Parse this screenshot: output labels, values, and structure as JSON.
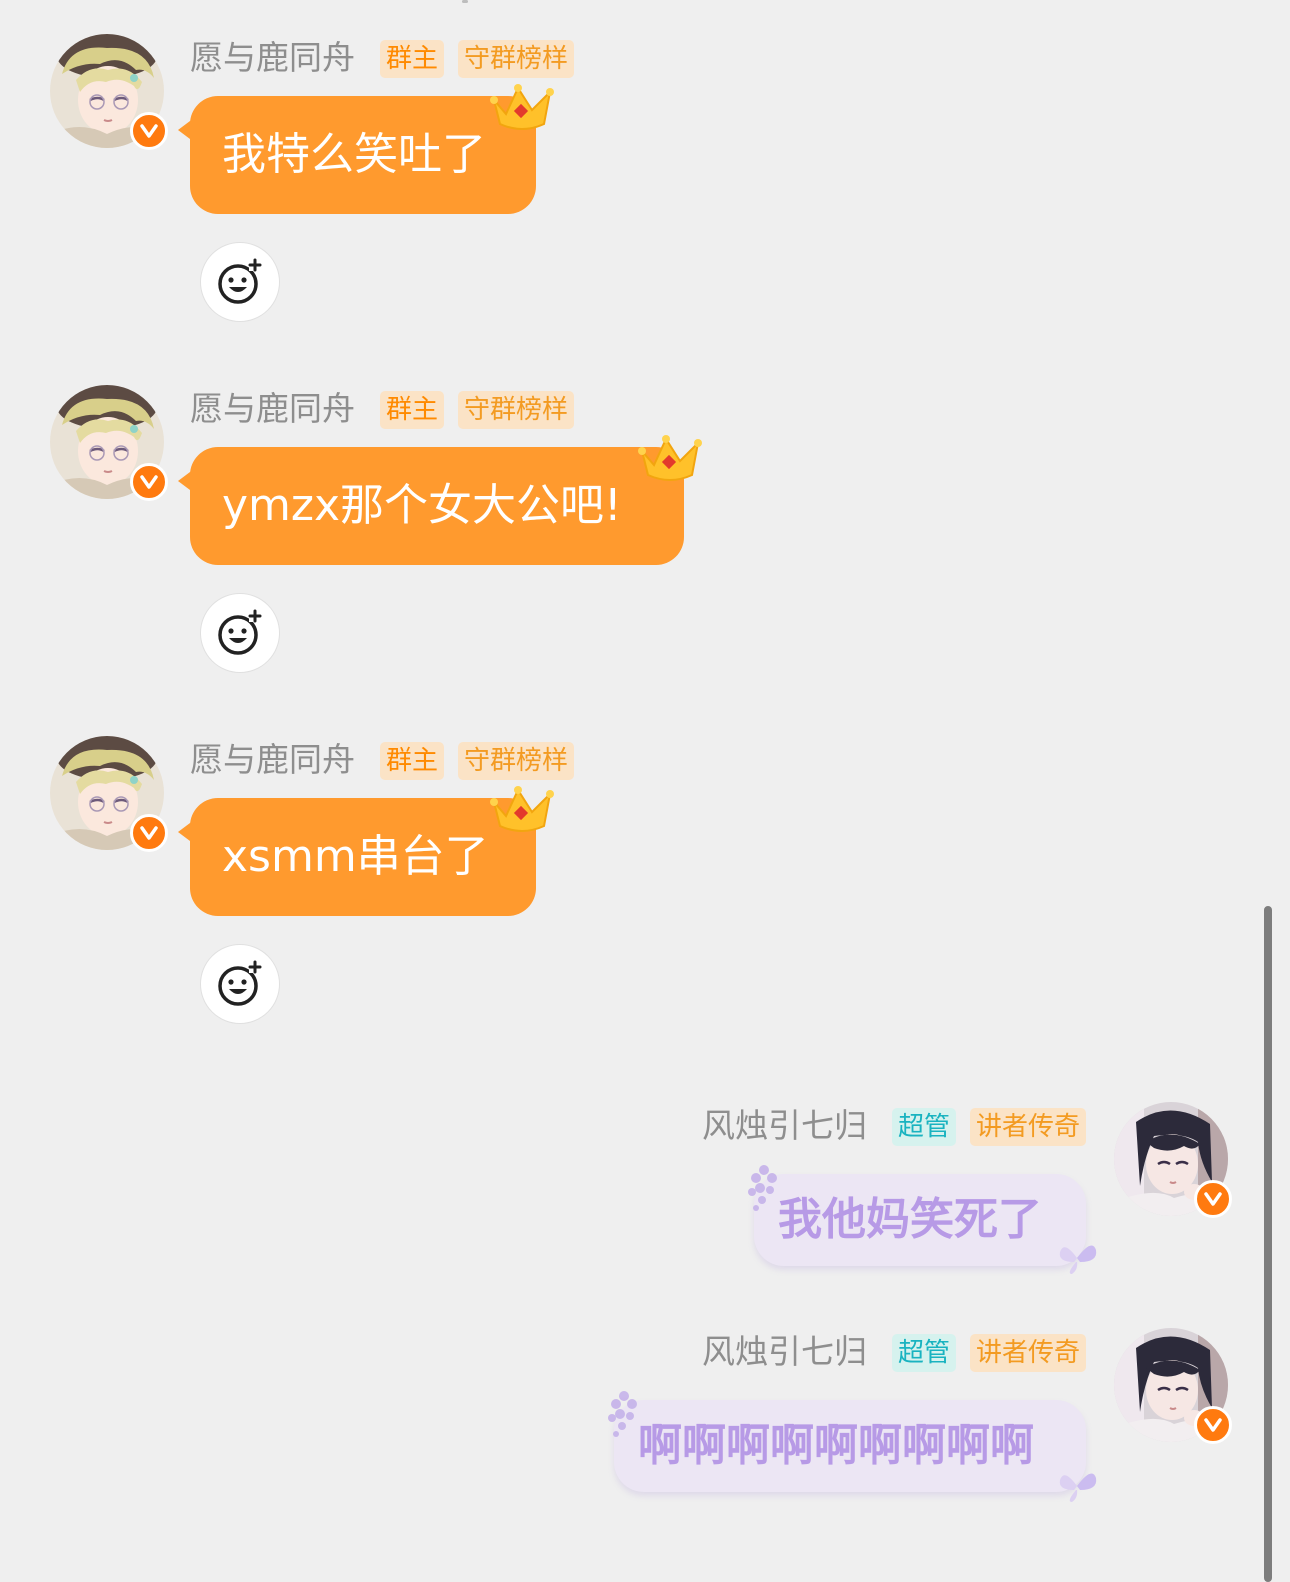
{
  "messages": [
    {
      "sender": "愿与鹿同舟",
      "badges": [
        "群主",
        "守群榜样"
      ],
      "text": "我特么笑吐了",
      "side": "left"
    },
    {
      "sender": "愿与鹿同舟",
      "badges": [
        "群主",
        "守群榜样"
      ],
      "text": "ymzx那个女大公吧!",
      "side": "left"
    },
    {
      "sender": "愿与鹿同舟",
      "badges": [
        "群主",
        "守群榜样"
      ],
      "text": "xsmm串台了",
      "side": "left"
    },
    {
      "sender": "风烛引七归",
      "badges": [
        "超管",
        "讲者传奇"
      ],
      "text": "我他妈笑死了",
      "side": "right"
    },
    {
      "sender": "风烛引七归",
      "badges": [
        "超管",
        "讲者传奇"
      ],
      "text": "啊啊啊啊啊啊啊啊啊",
      "side": "right"
    }
  ],
  "colors": {
    "background": "#efefef",
    "orange_bubble": "#ff9a2e",
    "purple_bubble": "#ece6f4",
    "purple_text": "#b79ae6",
    "verified": "#ff7a0f"
  },
  "icons": {
    "verified": "v-verified-icon",
    "reaction": "add-emoji-icon",
    "crown": "crown-icon"
  }
}
